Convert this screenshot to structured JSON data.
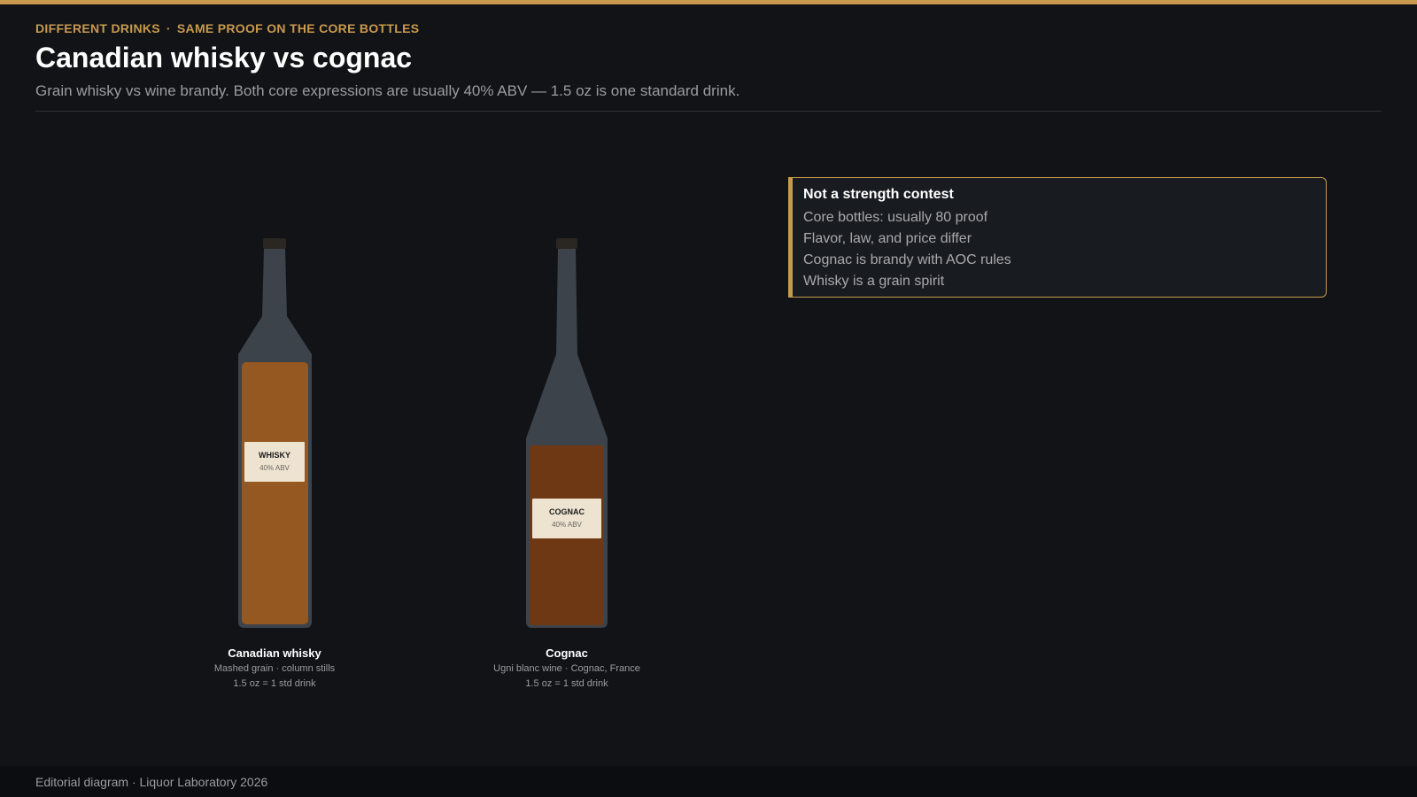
{
  "header": {
    "eyebrow_left": "DIFFERENT DRINKS",
    "eyebrow_separator": "·",
    "eyebrow_right": "SAME PROOF ON THE CORE BOTTLES",
    "title": "Canadian whisky vs cognac",
    "subtitle": "Grain whisky vs wine brandy. Both core expressions are usually 40% ABV — 1.5 oz is one standard drink."
  },
  "colors": {
    "accent": "#c99a4e",
    "background": "#111317",
    "bottle_glass": "#3d434b",
    "whisky_liquid": "#955820",
    "cognac_liquid": "#6e3814",
    "label": "#ede3d0"
  },
  "bottles": [
    {
      "name": "Canadian whisky",
      "label_title": "WHISKY",
      "label_abv": "40% ABV",
      "details": "Mashed grain  ·  column stills",
      "serving": "1.5 oz = 1 std drink"
    },
    {
      "name": "Cognac",
      "label_title": "COGNAC",
      "label_abv": "40% ABV",
      "details": "Ugni blanc wine  ·  Cognac, France",
      "serving": "1.5 oz = 1 std drink"
    }
  ],
  "callout": {
    "heading": "Not a strength contest",
    "points": [
      "Core bottles: usually 80 proof",
      "Flavor, law, and price differ",
      "Cognac is brandy with AOC rules",
      "Whisky is a grain spirit"
    ]
  },
  "footer": {
    "text": "Editorial diagram · Liquor Laboratory 2026"
  }
}
